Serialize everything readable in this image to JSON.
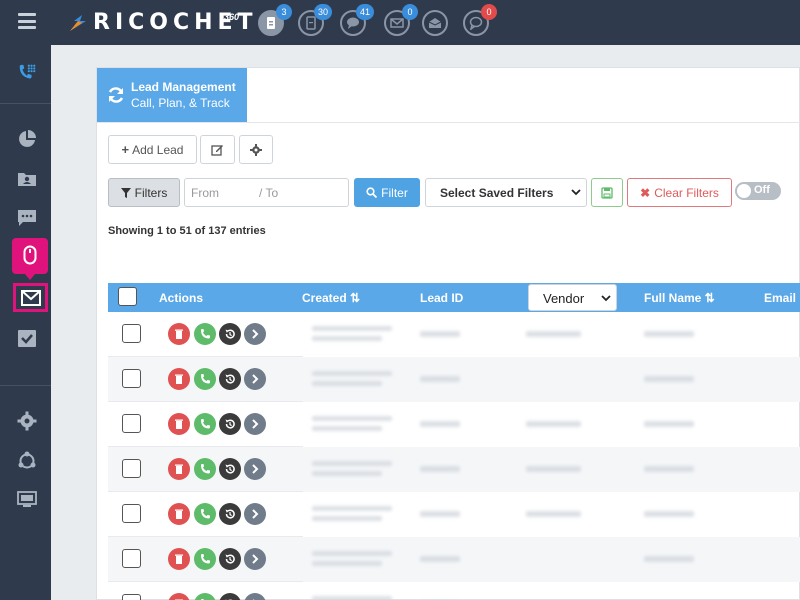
{
  "brand": {
    "name": "RICOCHET",
    "suffix": "360",
    "accent": "#e24b4b",
    "primary": "#5aa8e8"
  },
  "topbar": {
    "icons": [
      {
        "name": "leads-icon",
        "badge": "3",
        "badge_color": "blue"
      },
      {
        "name": "documents-icon",
        "badge": "30",
        "badge_color": "blue"
      },
      {
        "name": "chat-icon",
        "badge": "41",
        "badge_color": "blue"
      },
      {
        "name": "mail-icon",
        "badge": "0",
        "badge_color": "blue"
      },
      {
        "name": "open-mail-icon",
        "badge": "",
        "badge_color": ""
      },
      {
        "name": "message-icon",
        "badge": "0",
        "badge_color": "red"
      }
    ]
  },
  "panel": {
    "title": "Lead Management",
    "subtitle": "Call, Plan, & Track"
  },
  "toolbar": {
    "add_lead": "Add Lead"
  },
  "filters": {
    "filters_label": "Filters",
    "from_placeholder": "From",
    "to_placeholder": "/ To",
    "filter_button": "Filter",
    "saved_filters": "Select Saved Filters",
    "clear_filters": "Clear Filters",
    "toggle": "Off"
  },
  "table": {
    "info": "Showing 1 to 51 of 137 entries",
    "columns": {
      "actions": "Actions",
      "created": "Created ⇅",
      "lead_id": "Lead ID",
      "vendor": "Vendor",
      "full_name": "Full Name ⇅",
      "email": "Email"
    },
    "row_count": 7
  }
}
